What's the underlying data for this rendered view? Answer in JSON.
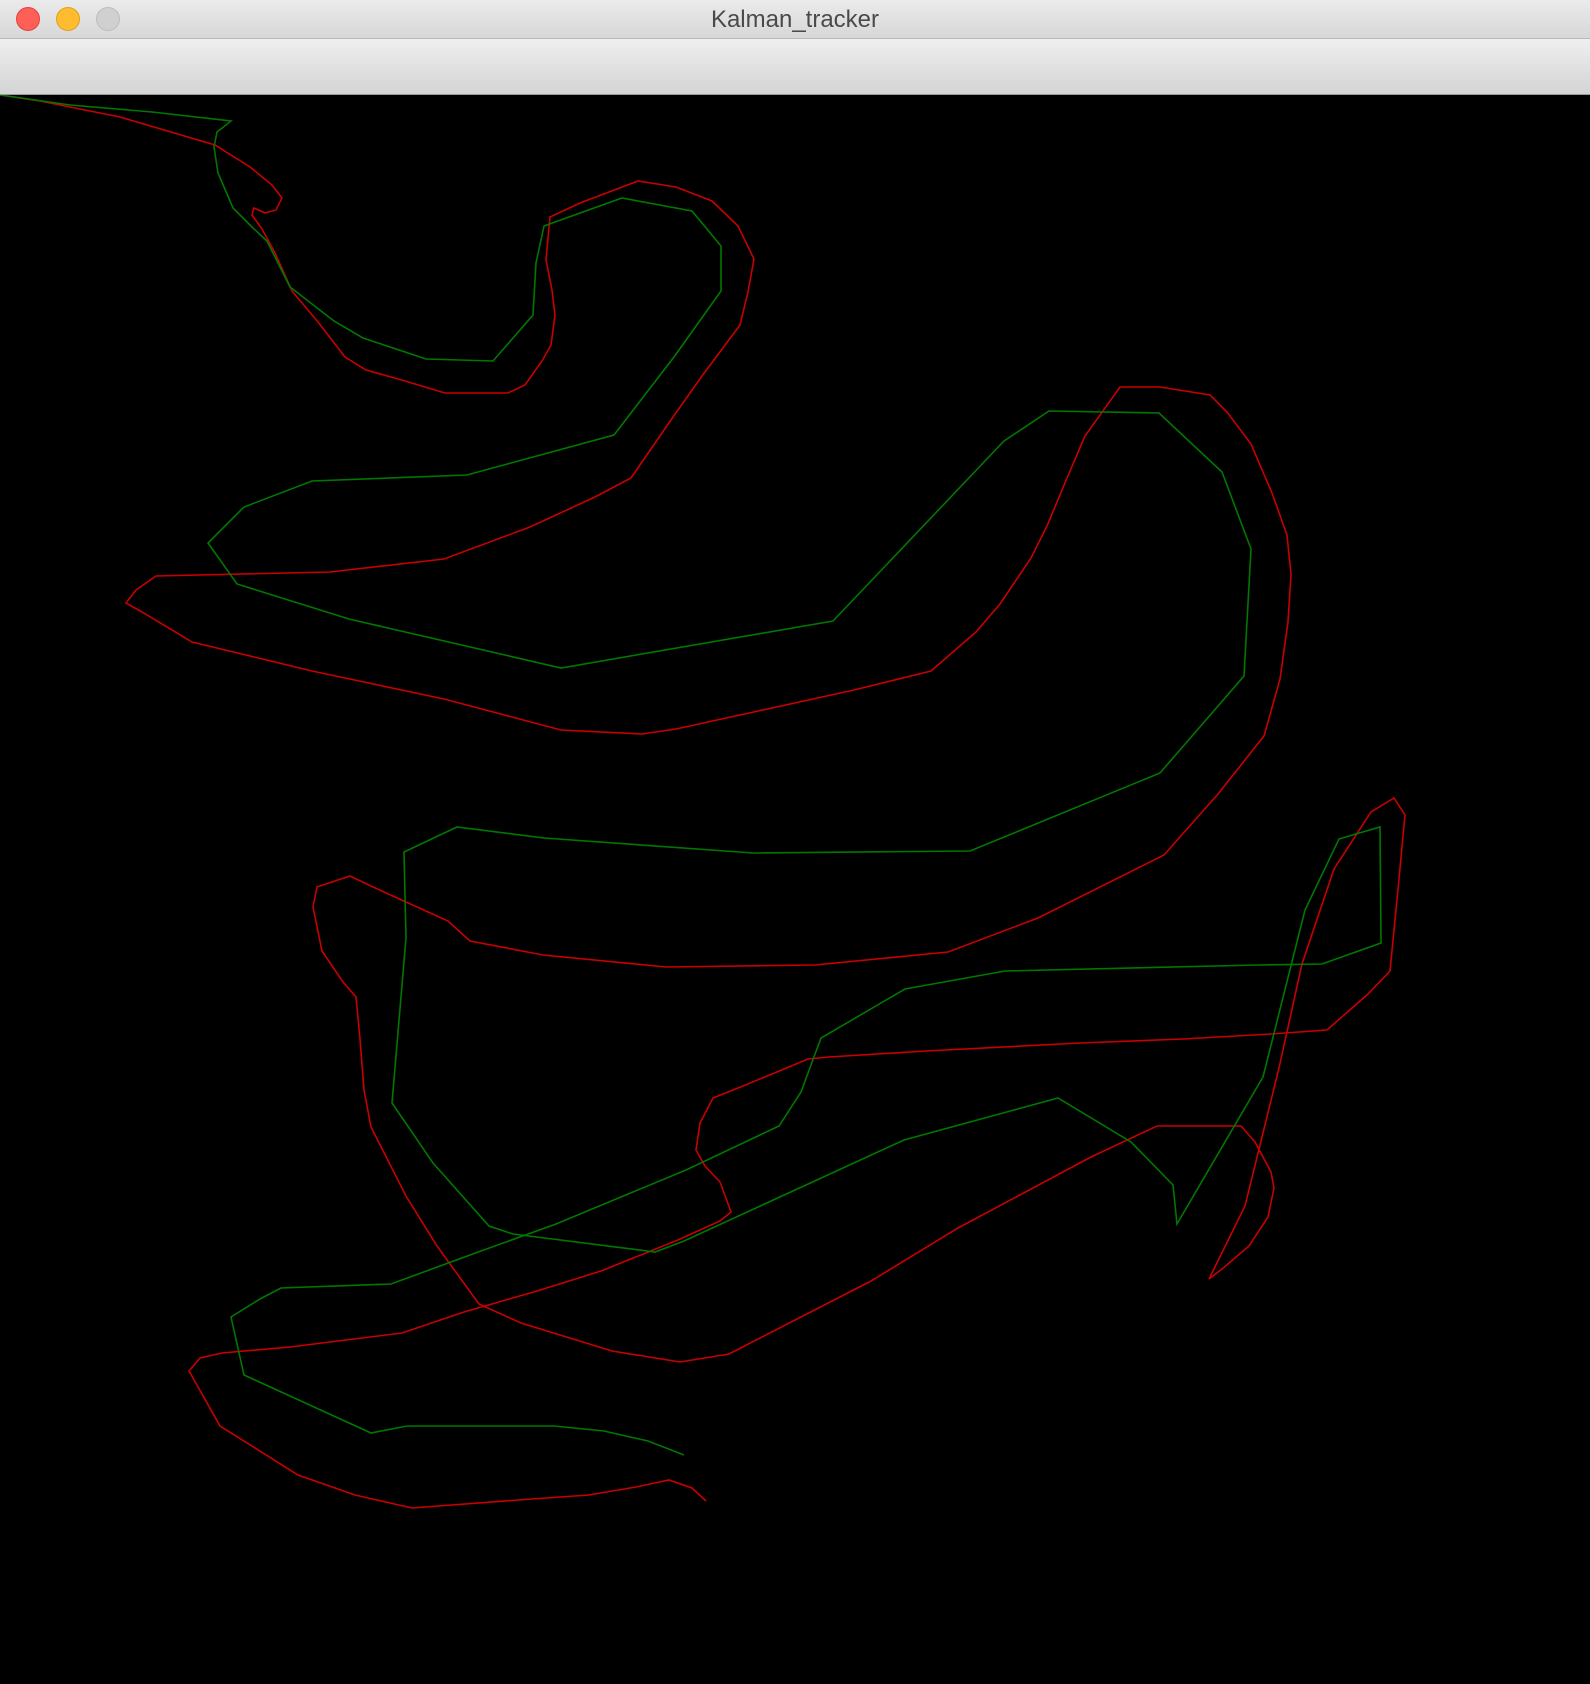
{
  "window": {
    "title": "Kalman_tracker",
    "buttons": {
      "close": "close-button",
      "minimize": "minimize-button",
      "zoom": "zoom-button"
    }
  },
  "colors": {
    "canvas_background": "#000000",
    "track_red": "#c80000",
    "track_green": "#007800"
  },
  "icons": {
    "close": "close-circle-icon",
    "minimize": "minimize-circle-icon",
    "zoom": "zoom-circle-icon"
  }
}
